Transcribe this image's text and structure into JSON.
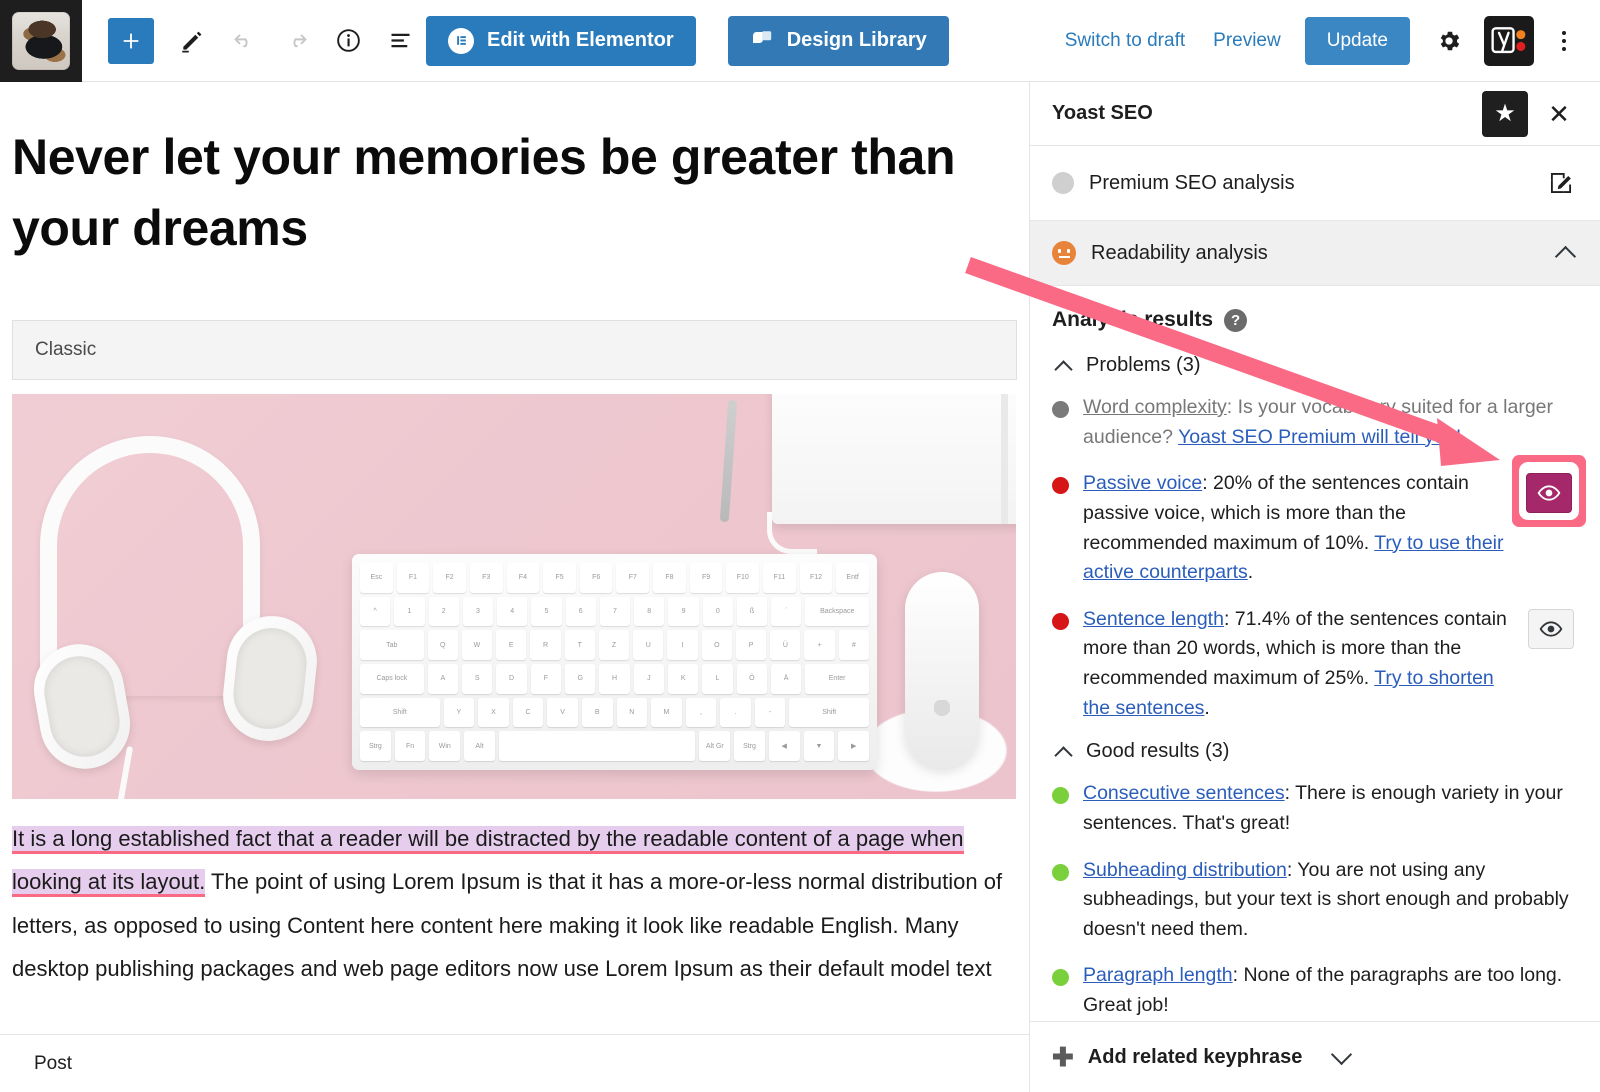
{
  "topbar": {
    "site_icon_name": "site-avatar-dog",
    "add_block_label": "+",
    "tools": [
      "add-block",
      "edit-pencil",
      "undo",
      "redo",
      "details-info",
      "list-view"
    ],
    "elementor_button": "Edit with Elementor",
    "design_library_button": "Design Library",
    "switch_to_draft": "Switch to draft",
    "preview": "Preview",
    "update": "Update",
    "settings_icon": "gear-icon",
    "yoast_icon": "yoast-logo-icon",
    "options_icon": "kebab-menu-icon"
  },
  "editor": {
    "post_title": "Never let your memories be greater than your dreams",
    "block_label": "Classic",
    "image_alt": "White headphones, keyboard, mouse, notebook and pencil on a pink background",
    "paragraph": {
      "highlighted": "It is a long established fact that a reader will be distracted by the readable content of a page when looking at its layout.",
      "rest": " The point of using Lorem Ipsum is that it has a more-or-less normal distribution of letters, as opposed to using Content here content here making it look like readable English. Many desktop publishing packages and web page editors now use Lorem Ipsum as their default model text"
    },
    "footer_breadcrumb": "Post"
  },
  "sidebar": {
    "title": "Yoast SEO",
    "star_icon": "star-icon",
    "close_icon": "close-icon",
    "premium_seo_analysis": "Premium SEO analysis",
    "readability_analysis": "Readability analysis",
    "analysis_results_title": "Analysis results",
    "help_icon": "question-mark-icon",
    "problems_header": "Problems (3)",
    "good_header": "Good results (3)",
    "problems": [
      {
        "dot": "grey",
        "link": "Word complexity",
        "text": ": Is your vocabulary suited for a larger audience? ",
        "link2": "Yoast SEO Premium will tell you!",
        "tail": "",
        "eye": false,
        "eye_active": false,
        "highlighted": false
      },
      {
        "dot": "red",
        "link": "Passive voice",
        "text": ": 20% of the sentences contain passive voice, which is more than the recommended maximum of 10%. ",
        "link2": "Try to use their active counterparts",
        "tail": ".",
        "eye": true,
        "eye_active": true,
        "highlighted": true
      },
      {
        "dot": "red",
        "link": "Sentence length",
        "text": ": 71.4% of the sentences contain more than 20 words, which is more than the recommended maximum of 25%. ",
        "link2": "Try to shorten the sentences",
        "tail": ".",
        "eye": true,
        "eye_active": false,
        "highlighted": false
      }
    ],
    "good_results": [
      {
        "dot": "green",
        "link": "Consecutive sentences",
        "text": ": There is enough variety in your sentences. That's great!",
        "link2": "",
        "tail": ""
      },
      {
        "dot": "green",
        "link": "Subheading distribution",
        "text": ": You are not using any subheadings, but your text is short enough and probably doesn't need them.",
        "link2": "",
        "tail": ""
      },
      {
        "dot": "green",
        "link": "Paragraph length",
        "text": ": None of the paragraphs are too long. Great job!",
        "link2": "",
        "tail": ""
      }
    ],
    "add_related_keyphrase": "Add related keyphrase"
  },
  "annotation": {
    "arrow_color": "#fa6a85",
    "highlight_box_color": "#fa6a85"
  },
  "colors": {
    "accent_blue": "#2a7bbb",
    "link_blue": "#2a5dbb",
    "bad_red": "#d61616",
    "good_green": "#7ad03a",
    "neutral_grey": "#7a7a7a",
    "yoast_purple": "#a4286a",
    "annotation_pink": "#fa6a85",
    "highlight_lilac": "#e6cded"
  },
  "keyboard_rows": [
    [
      "Esc",
      "F1",
      "F2",
      "F3",
      "F4",
      "F5",
      "F6",
      "F7",
      "F8",
      "F9",
      "F10",
      "F11",
      "F12",
      "Entf"
    ],
    [
      "^",
      "1",
      "2",
      "3",
      "4",
      "5",
      "6",
      "7",
      "8",
      "9",
      "0",
      "ß",
      "´",
      "Backspace"
    ],
    [
      "Tab",
      "Q",
      "W",
      "E",
      "R",
      "T",
      "Z",
      "U",
      "I",
      "O",
      "P",
      "Ü",
      "+",
      "#"
    ],
    [
      "Caps lock",
      "A",
      "S",
      "D",
      "F",
      "G",
      "H",
      "J",
      "K",
      "L",
      "Ö",
      "Ä",
      "Enter"
    ],
    [
      "Shift",
      "Y",
      "X",
      "C",
      "V",
      "B",
      "N",
      "M",
      ",",
      ".",
      "-",
      "Shift"
    ],
    [
      "Strg",
      "Fn",
      "Win",
      "Alt",
      "",
      "Alt Gr",
      "Strg",
      "◀",
      "▼",
      "▶"
    ]
  ]
}
